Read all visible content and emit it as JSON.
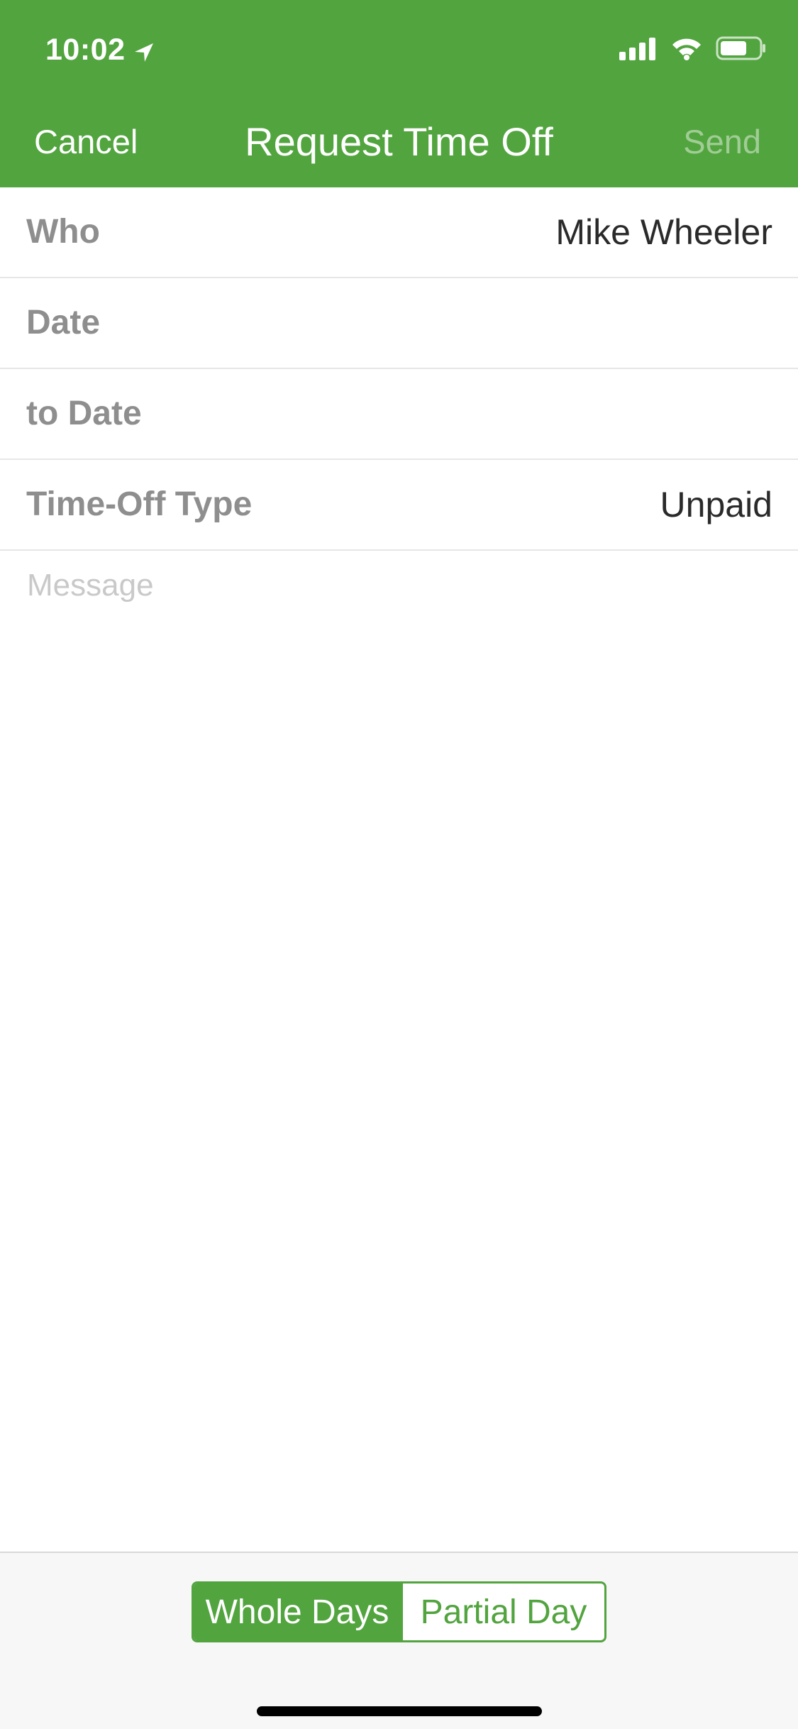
{
  "status_bar": {
    "time": "10:02",
    "icons": [
      "location-arrow-icon",
      "cellular-signal-icon",
      "wifi-icon",
      "battery-icon"
    ]
  },
  "nav_bar": {
    "cancel_label": "Cancel",
    "title": "Request Time Off",
    "send_label": "Send"
  },
  "form": {
    "rows": [
      {
        "label": "Who",
        "value": "Mike Wheeler"
      },
      {
        "label": "Date",
        "value": ""
      },
      {
        "label": "to Date",
        "value": ""
      },
      {
        "label": "Time-Off Type",
        "value": "Unpaid"
      }
    ],
    "message_placeholder": "Message"
  },
  "duration_toggle": {
    "options": [
      "Whole Days",
      "Partial Day"
    ],
    "selected": "Whole Days"
  },
  "colors": {
    "brand_green": "#52a43f",
    "label_gray": "#8e8e8e",
    "placeholder_gray": "#c9c9c9"
  }
}
